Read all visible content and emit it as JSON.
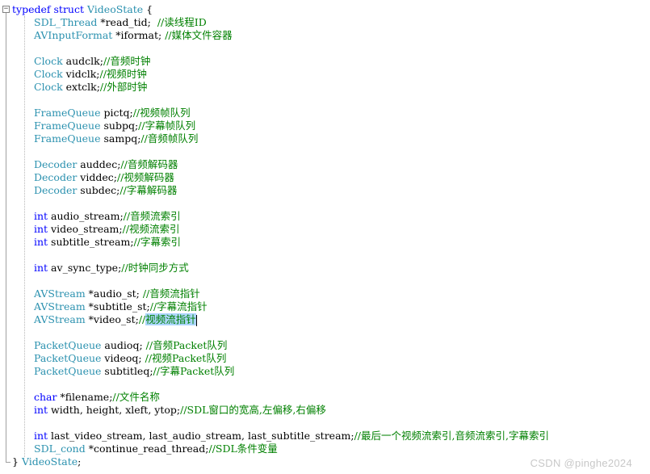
{
  "editor": {
    "header": {
      "kw": "typedef",
      "kw2": "struct",
      "name": "VideoState",
      "brace": " {"
    },
    "fields": {
      "read_tid": {
        "type": "SDL_Thread",
        "decl": " *read_tid;  ",
        "comment": "//读线程ID"
      },
      "iformat": {
        "type": "AVInputFormat",
        "decl": " *iformat; ",
        "comment": "//媒体文件容器"
      },
      "audclk": {
        "type": "Clock",
        "decl": " audclk;",
        "comment": "//音频时钟"
      },
      "vidclk": {
        "type": "Clock",
        "decl": " vidclk;",
        "comment": "//视频时钟"
      },
      "extclk": {
        "type": "Clock",
        "decl": " extclk;",
        "comment": "//外部时钟"
      },
      "pictq": {
        "type": "FrameQueue",
        "decl": " pictq;",
        "comment": "//视频帧队列"
      },
      "subpq": {
        "type": "FrameQueue",
        "decl": " subpq;",
        "comment": "//字幕帧队列"
      },
      "sampq": {
        "type": "FrameQueue",
        "decl": " sampq;",
        "comment": "//音频帧队列"
      },
      "auddec": {
        "type": "Decoder",
        "decl": " auddec;",
        "comment": "//音频解码器"
      },
      "viddec": {
        "type": "Decoder",
        "decl": " viddec;",
        "comment": "//视频解码器"
      },
      "subdec": {
        "type": "Decoder",
        "decl": " subdec;",
        "comment": "//字幕解码器"
      },
      "audio_stream": {
        "type": "int",
        "decl": " audio_stream;",
        "comment": "//音频流索引"
      },
      "video_stream": {
        "type": "int",
        "decl": " video_stream;",
        "comment": "//视频流索引"
      },
      "subtitle_stream": {
        "type": "int",
        "decl": " subtitle_stream;",
        "comment": "//字幕索引"
      },
      "av_sync_type": {
        "type": "int",
        "decl": " av_sync_type;",
        "comment": "//时钟同步方式"
      },
      "audio_st": {
        "type": "AVStream",
        "decl": " *audio_st; ",
        "comment": "//音频流指针"
      },
      "subtitle_st": {
        "type": "AVStream",
        "decl": " *subtitle_st;",
        "comment": "//字幕流指针"
      },
      "video_st": {
        "type": "AVStream",
        "decl": " *video_st;",
        "comment_prefix": "//",
        "comment_selected": "视频流指针"
      },
      "audioq": {
        "type": "PacketQueue",
        "decl": " audioq; ",
        "comment": "//音频Packet队列"
      },
      "videoq": {
        "type": "PacketQueue",
        "decl": " videoq; ",
        "comment": "//视频Packet队列"
      },
      "subtitleq": {
        "type": "PacketQueue",
        "decl": " subtitleq;",
        "comment": "//字幕Packet队列"
      },
      "filename": {
        "type": "char",
        "decl": " *filename;",
        "comment": "//文件名称"
      },
      "geometry": {
        "type": "int",
        "decl": " width, height, xleft, ytop;",
        "comment": "//SDL窗口的宽高,左偏移,右偏移"
      },
      "last_streams": {
        "type": "int",
        "decl": " last_video_stream, last_audio_stream, last_subtitle_stream;",
        "comment": "//最后一个视频流索引,音频流索引,字幕索引"
      },
      "continue_read_thread": {
        "type": "SDL_cond",
        "decl": " *continue_read_thread;",
        "comment": "//SDL条件变量"
      }
    },
    "footer": {
      "brace": "} ",
      "name": "VideoState",
      "semi": ";"
    }
  },
  "watermark": "CSDN @pinghe2024",
  "colors": {
    "keyword": "#0000ff",
    "type": "#2b91af",
    "comment": "#008000",
    "selection": "#add6ff"
  }
}
